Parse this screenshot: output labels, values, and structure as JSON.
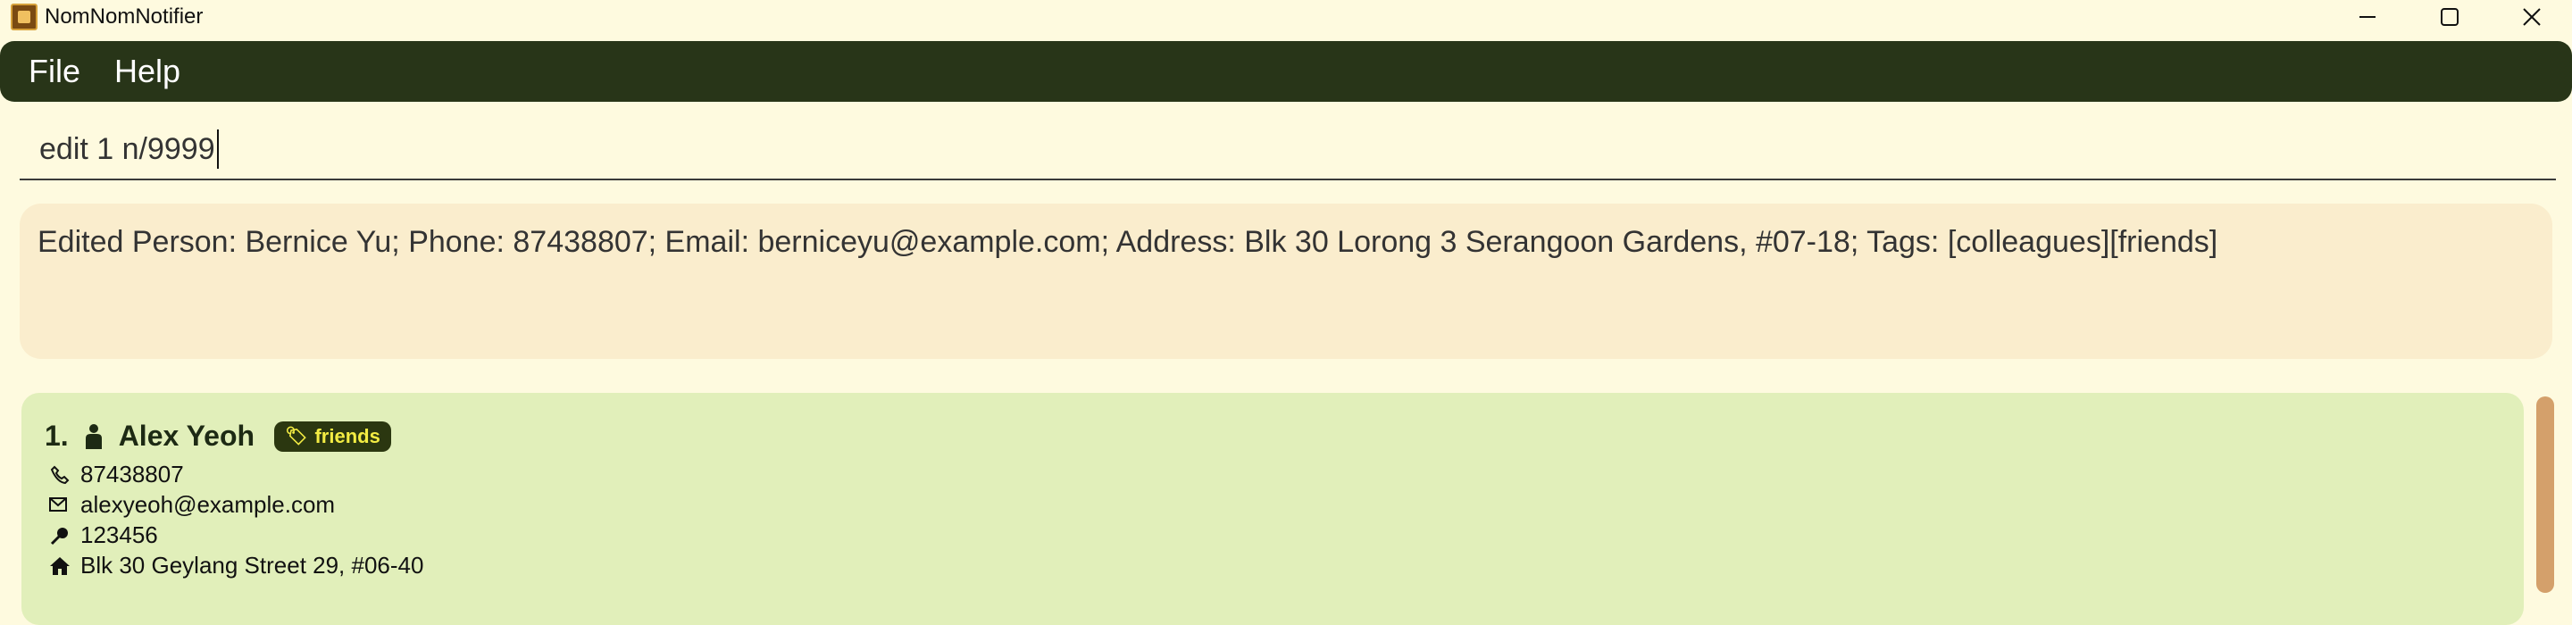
{
  "window": {
    "title": "NomNomNotifier",
    "controls": {
      "minimize_icon": "minimize-icon",
      "maximize_icon": "maximize-icon",
      "close_icon": "close-icon"
    }
  },
  "menu": {
    "items": [
      {
        "label": "File"
      },
      {
        "label": "Help"
      }
    ]
  },
  "command": {
    "value": "edit 1 n/9999"
  },
  "result": {
    "text": "Edited Person: Bernice Yu; Phone: 87438807; Email: berniceyu@example.com; Address: Blk 30 Lorong 3 Serangoon Gardens, #07-18; Tags: [colleagues][friends]"
  },
  "persons": [
    {
      "index": "1.",
      "name": "Alex Yeoh",
      "tags": [
        {
          "label": "friends"
        }
      ],
      "phone": "87438807",
      "email": "alexyeoh@example.com",
      "postal": "123456",
      "address": "Blk 30 Geylang Street 29, #06-40"
    }
  ],
  "colors": {
    "background": "#fefadf",
    "menubar": "#283518",
    "result_box": "#faedcd",
    "card": "#e1efba",
    "tag_bg": "#2b3710",
    "tag_text": "#f3ec43",
    "scrollbar": "#d4a06b"
  }
}
